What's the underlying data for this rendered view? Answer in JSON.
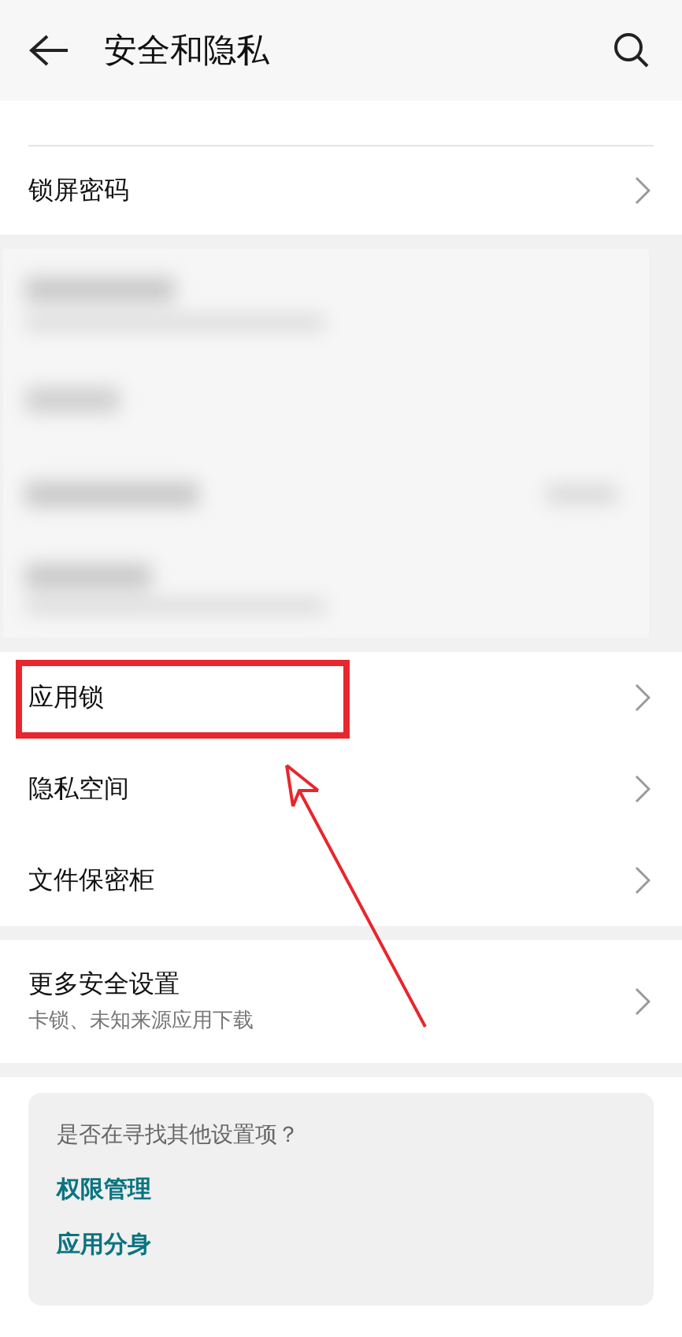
{
  "header": {
    "title": "安全和隐私"
  },
  "groups": [
    {
      "kind": "list",
      "rows": [
        {
          "label": "锁屏密码",
          "highlighted": false
        }
      ]
    },
    {
      "kind": "picture"
    },
    {
      "kind": "list",
      "rows": [
        {
          "label": "应用锁",
          "highlighted": true
        },
        {
          "label": "隐私空间",
          "highlighted": false
        },
        {
          "label": "文件保密柜",
          "highlighted": false
        }
      ]
    },
    {
      "kind": "list",
      "rows": [
        {
          "label": "更多安全设置",
          "subtitle": "卡锁、未知来源应用下载",
          "highlighted": false
        }
      ]
    }
  ],
  "suggestions": {
    "question": "是否在寻找其他设置项？",
    "links": [
      "权限管理",
      "应用分身"
    ]
  }
}
